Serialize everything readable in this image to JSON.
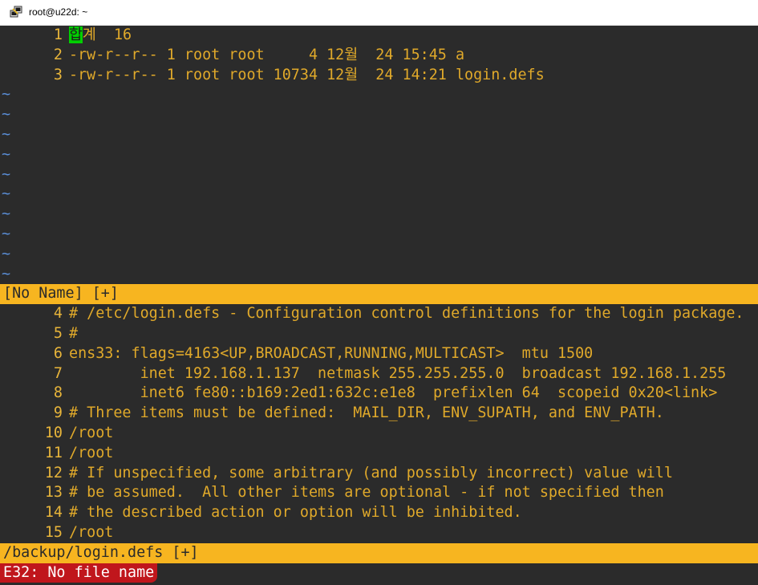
{
  "window": {
    "title": "root@u22d: ~",
    "icon": "putty-icon"
  },
  "top_pane": {
    "lines": [
      {
        "num": "1",
        "cursor": "합",
        "text": "계  16"
      },
      {
        "num": "2",
        "text": "-rw-r--r-- 1 root root     4 12월  24 15:45 a"
      },
      {
        "num": "3",
        "text": "-rw-r--r-- 1 root root 10734 12월  24 14:21 login.defs"
      }
    ],
    "empty_marker": "~",
    "empty_count": 10,
    "status": "[No Name] [+]"
  },
  "bottom_pane": {
    "lines": [
      {
        "num": "4",
        "text": "# /etc/login.defs - Configuration control definitions for the login package."
      },
      {
        "num": "5",
        "text": "#"
      },
      {
        "num": "6",
        "text": "ens33: flags=4163<UP,BROADCAST,RUNNING,MULTICAST>  mtu 1500"
      },
      {
        "num": "7",
        "text": "        inet 192.168.1.137  netmask 255.255.255.0  broadcast 192.168.1.255"
      },
      {
        "num": "8",
        "text": "        inet6 fe80::b169:2ed1:632c:e1e8  prefixlen 64  scopeid 0x20<link>"
      },
      {
        "num": "9",
        "text": "# Three items must be defined:  MAIL_DIR, ENV_SUPATH, and ENV_PATH."
      },
      {
        "num": "10",
        "text": "/root"
      },
      {
        "num": "11",
        "text": "/root"
      },
      {
        "num": "12",
        "text": "# If unspecified, some arbitrary (and possibly incorrect) value will"
      },
      {
        "num": "13",
        "text": "# be assumed.  All other items are optional - if not specified then"
      },
      {
        "num": "14",
        "text": "# the described action or option will be inhibited."
      },
      {
        "num": "15",
        "text": "/root"
      }
    ],
    "status": "/backup/login.defs [+]"
  },
  "command_line": {
    "message": "E32: No file name"
  },
  "colors": {
    "background": "#2b2b2b",
    "text": "#e0a92a",
    "status_bar": "#f7b520",
    "tilde": "#5a8ed6",
    "cursor": "#00d000",
    "error_bg": "#c0161c"
  }
}
